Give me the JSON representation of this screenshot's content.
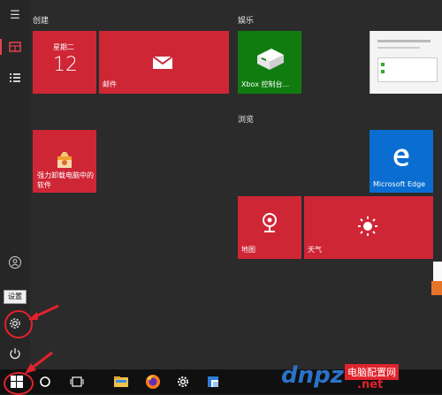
{
  "groups": {
    "create": "创建",
    "entertainment": "娱乐",
    "browse": "浏览"
  },
  "tiles": {
    "calendar": {
      "weekday": "星期二",
      "day": "12"
    },
    "mail": {
      "label": "邮件"
    },
    "xbox": {
      "label": "Xbox 控制台..."
    },
    "uninstall": {
      "label": "强力卸载电脑中的软件"
    },
    "edge": {
      "label": "Microsoft Edge"
    },
    "maps": {
      "label": "地图"
    },
    "weather": {
      "label": "天气"
    }
  },
  "tooltip": {
    "settings": "设置"
  },
  "watermark": {
    "text1": "dnpz",
    "text2": "电脑配置网",
    "text3": ".net"
  },
  "colors": {
    "tile_red": "#cf2636",
    "xbox_green": "#107c10",
    "edge_blue": "#0a6dd1"
  }
}
